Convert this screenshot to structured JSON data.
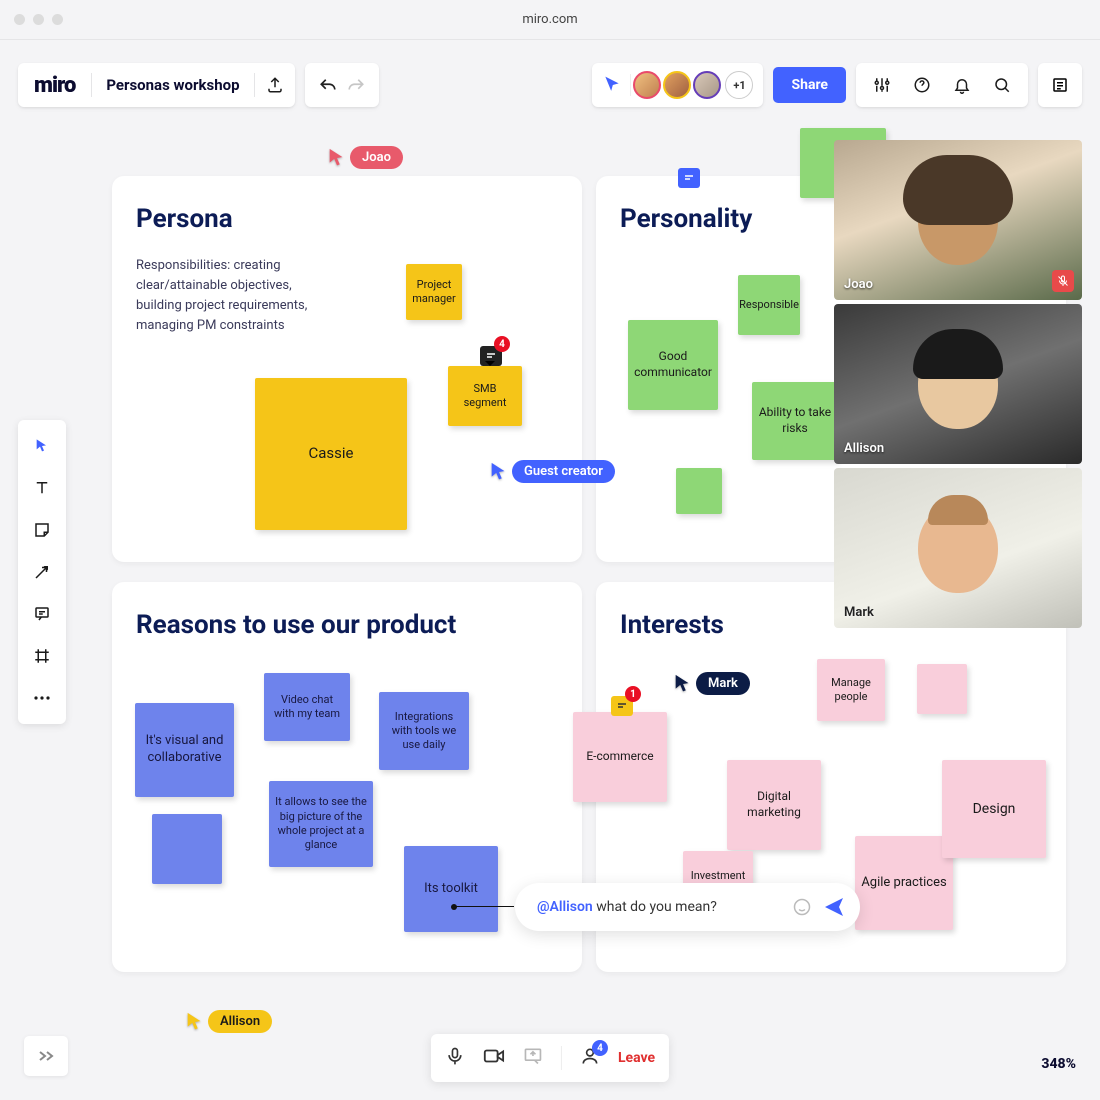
{
  "browser": {
    "url": "miro.com"
  },
  "header": {
    "logo": "miro",
    "board_name": "Personas workshop",
    "overflow_count": "+1",
    "share": "Share"
  },
  "cursors": {
    "joao": "Joao",
    "guest": "Guest creator",
    "mark": "Mark",
    "allison": "Allison"
  },
  "panels": {
    "persona": {
      "title": "Persona",
      "desc": "Responsibilities: creating clear/attainable objectives, building project requirements, managing PM constraints"
    },
    "personality": {
      "title": "Personality"
    },
    "reasons": {
      "title": "Reasons to use our product"
    },
    "interests": {
      "title": "Interests"
    }
  },
  "stickies": {
    "cassie": "Cassie",
    "project_manager": "Project manager",
    "smb": "SMB segment",
    "good_comm": "Good communicator",
    "responsible": "Responsible",
    "ability": "Ability to take risks",
    "visual": "It's visual and collaborative",
    "videochat": "Video chat with my team",
    "integrations": "Integrations with tools we use daily",
    "bigpicture": "It allows to see the big picture of the whole project at a glance",
    "toolkit": "Its toolkit",
    "ecommerce": "E-commerce",
    "manage_people": "Manage people",
    "digital": "Digital marketing",
    "investment": "Investment",
    "agile": "Agile practices",
    "design": "Design"
  },
  "badges": {
    "four": "4",
    "one": "1",
    "people": "4"
  },
  "video": {
    "joao": "Joao",
    "allison": "Allison",
    "mark": "Mark"
  },
  "comment": {
    "mention": "@Allison",
    "text": " what do you mean?"
  },
  "bottom": {
    "leave": "Leave"
  },
  "zoom": "348%"
}
